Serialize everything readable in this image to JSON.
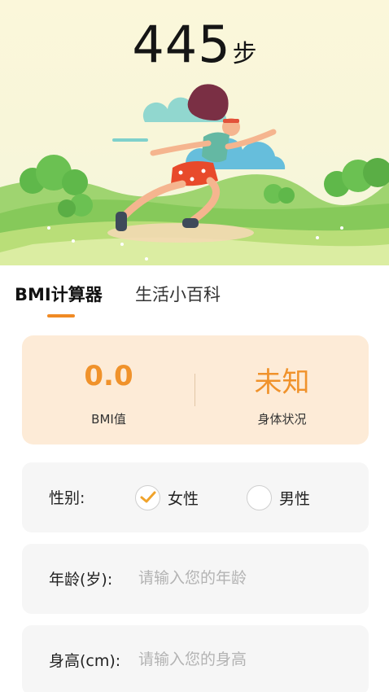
{
  "header": {
    "steps_value": "445",
    "steps_unit": "步"
  },
  "tabs": [
    {
      "label": "BMI计算器",
      "active": true
    },
    {
      "label": "生活小百科",
      "active": false
    }
  ],
  "result": {
    "bmi_value": "0.0",
    "bmi_label": "BMI值",
    "status_value": "未知",
    "status_label": "身体状况"
  },
  "form": {
    "gender_label": "性别:",
    "female_label": "女性",
    "male_label": "男性",
    "female_selected": true,
    "age_label": "年龄(岁):",
    "age_placeholder": "请输入您的年龄",
    "age_value": "",
    "height_label": "身高(cm):",
    "height_placeholder": "请输入您的身高",
    "height_value": ""
  },
  "colors": {
    "accent": "#f08a24",
    "result_bg": "#fdebd7",
    "result_text": "#f0922b",
    "row_bg": "#f6f6f6"
  },
  "icons": [
    "runner-illustration",
    "checkmark-icon"
  ]
}
